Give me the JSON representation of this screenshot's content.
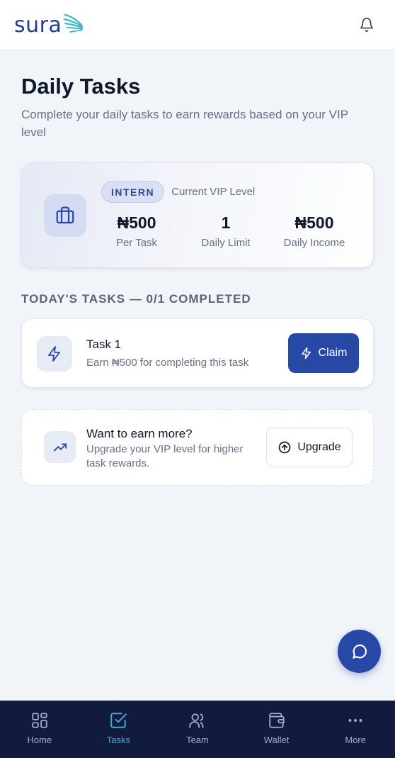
{
  "header": {
    "logo_text": "sura",
    "notification_icon": "bell-icon"
  },
  "page": {
    "title": "Daily Tasks",
    "subtitle": "Complete your daily tasks to earn rewards based on your VIP level"
  },
  "vip_card": {
    "icon": "briefcase-icon",
    "level_badge": "INTERN",
    "level_caption": "Current VIP Level",
    "stats": [
      {
        "value": "₦500",
        "label": "Per Task"
      },
      {
        "value": "1",
        "label": "Daily Limit"
      },
      {
        "value": "₦500",
        "label": "Daily Income"
      }
    ]
  },
  "tasks_section": {
    "heading": "TODAY'S TASKS — 0/1 COMPLETED",
    "tasks": [
      {
        "title": "Task 1",
        "description": "Earn ₦500 for completing this task",
        "button_label": "Claim",
        "icon": "lightning-icon"
      }
    ]
  },
  "upsell": {
    "icon": "trending-up-icon",
    "title": "Want to earn more?",
    "description": "Upgrade your VIP level for higher task rewards.",
    "button_label": "Upgrade"
  },
  "chat_fab": {
    "icon": "chat-bubble-icon"
  },
  "bottom_nav": {
    "items": [
      {
        "label": "Home",
        "icon": "grid-icon",
        "active": false
      },
      {
        "label": "Tasks",
        "icon": "checkbox-icon",
        "active": true
      },
      {
        "label": "Team",
        "icon": "users-icon",
        "active": false
      },
      {
        "label": "Wallet",
        "icon": "wallet-icon",
        "active": false
      },
      {
        "label": "More",
        "icon": "more-dots-icon",
        "active": false
      }
    ]
  },
  "colors": {
    "brand": "#243a8f",
    "accent": "#2848a6",
    "nav_background": "#111b3e",
    "nav_active": "#4aa7d8",
    "page_background": "#f1f4f9"
  }
}
